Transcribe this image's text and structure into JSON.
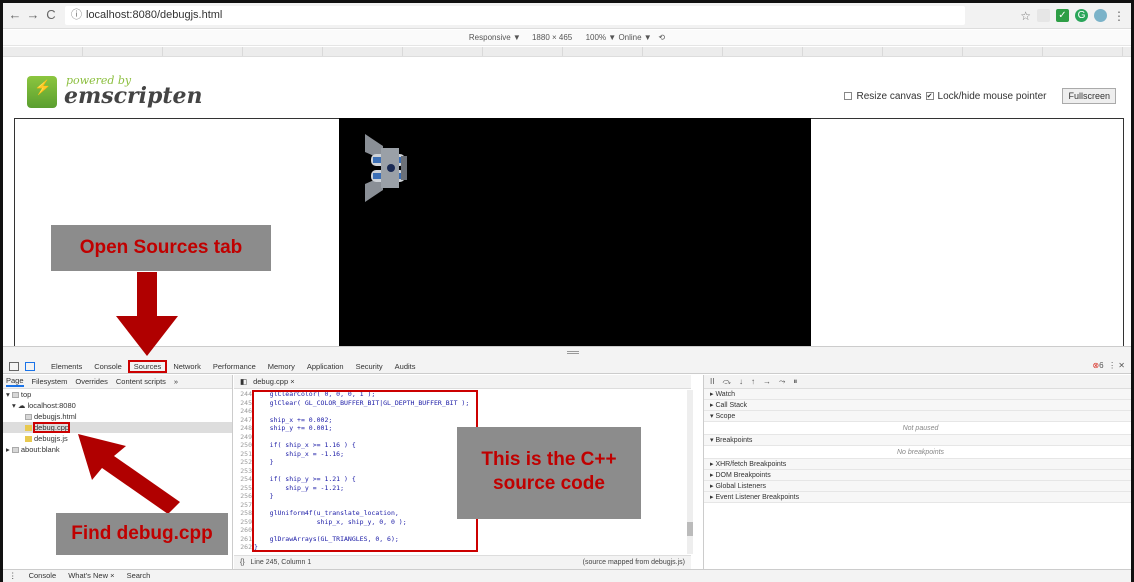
{
  "browser": {
    "url": "localhost:8080/debugjs.html",
    "responsive_label": "Responsive ▼",
    "width": "1880",
    "times": "×",
    "height": "465",
    "zoom": "100% ▼",
    "network": "Online ▼"
  },
  "emscripten": {
    "powered_by": "powered by",
    "name": "emscripten",
    "resize_canvas": "Resize canvas",
    "lock_pointer": "Lock/hide mouse pointer",
    "fullscreen": "Fullscreen"
  },
  "devtools": {
    "tabs": [
      "Elements",
      "Console",
      "Sources",
      "Network",
      "Performance",
      "Memory",
      "Application",
      "Security",
      "Audits"
    ],
    "error_count": "6",
    "nav_tabs": [
      "Page",
      "Filesystem",
      "Overrides",
      "Content scripts",
      "»"
    ],
    "tree": {
      "top": "top",
      "host": "localhost:8080",
      "file1": "debugjs.html",
      "file2": "debug.cpp",
      "file3": "debugjs.js",
      "blank": "about:blank"
    },
    "editor_tab": "debug.cpp ×",
    "code_lines": [
      {
        "n": "244",
        "t": "    glClearColor( 0, 0, 0, 1 );"
      },
      {
        "n": "245",
        "t": "    glClear( GL_COLOR_BUFFER_BIT|GL_DEPTH_BUFFER_BIT );"
      },
      {
        "n": "246",
        "t": ""
      },
      {
        "n": "247",
        "t": "    ship_x += 0.002;"
      },
      {
        "n": "248",
        "t": "    ship_y += 0.001;"
      },
      {
        "n": "249",
        "t": ""
      },
      {
        "n": "250",
        "t": "    if( ship_x >= 1.16 ) {"
      },
      {
        "n": "251",
        "t": "        ship_x = -1.16;"
      },
      {
        "n": "252",
        "t": "    }"
      },
      {
        "n": "253",
        "t": ""
      },
      {
        "n": "254",
        "t": "    if( ship_y >= 1.21 ) {"
      },
      {
        "n": "255",
        "t": "        ship_y = -1.21;"
      },
      {
        "n": "256",
        "t": "    }"
      },
      {
        "n": "257",
        "t": ""
      },
      {
        "n": "258",
        "t": "    glUniform4f(u_translate_location,"
      },
      {
        "n": "259",
        "t": "                ship_x, ship_y, 0, 0 );"
      },
      {
        "n": "260",
        "t": ""
      },
      {
        "n": "261",
        "t": "    glDrawArrays(GL_TRIANGLES, 0, 6);"
      },
      {
        "n": "262",
        "t": "}"
      }
    ],
    "status_left": "Line 245, Column 1",
    "status_right": "(source mapped from debugjs.js)",
    "debug_sections": {
      "watch": "▸ Watch",
      "call_stack": "▸ Call Stack",
      "scope": "▾ Scope",
      "not_paused": "Not paused",
      "breakpoints": "▾ Breakpoints",
      "no_breakpoints": "No breakpoints",
      "xhr": "▸ XHR/fetch Breakpoints",
      "dom": "▸ DOM Breakpoints",
      "global": "▸ Global Listeners",
      "event": "▸ Event Listener Breakpoints"
    },
    "drawer": [
      "Console",
      "What's New ×",
      "Search"
    ]
  },
  "annotations": {
    "open_sources": "Open Sources tab",
    "cpp_line1": "This is the C++",
    "cpp_line2": "source code",
    "find_debug": "Find debug.cpp",
    "color": "#c00000"
  }
}
